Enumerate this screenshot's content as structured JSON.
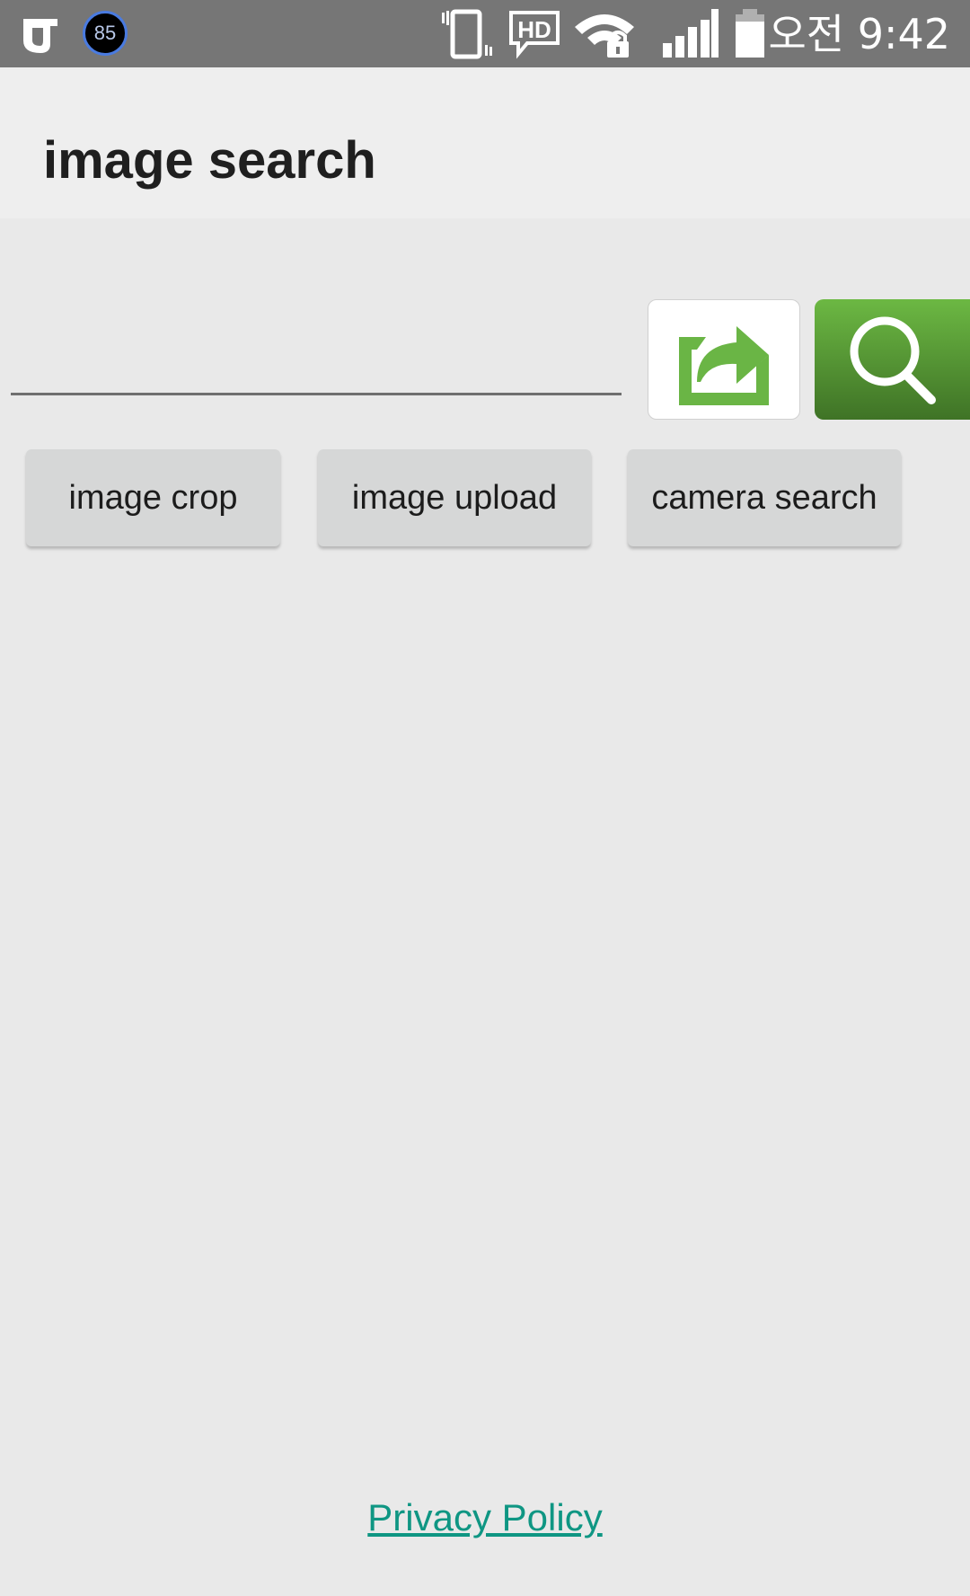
{
  "status_bar": {
    "badge_value": "85",
    "icons": [
      "app-logo-icon",
      "vibrate-icon",
      "hd-voice-icon",
      "wifi-lock-icon",
      "signal-icon",
      "battery-icon"
    ],
    "time": "오전 9:42"
  },
  "toolbar": {
    "title": "image search"
  },
  "search": {
    "value": "",
    "placeholder": ""
  },
  "buttons": {
    "share_icon": "share-icon",
    "search_icon": "search-icon",
    "image_crop": "image crop",
    "image_upload": "image upload",
    "camera_search": "camera search"
  },
  "footer": {
    "privacy_policy": "Privacy Policy"
  },
  "colors": {
    "accent_green": "#6cb843",
    "link_teal": "#0f9683"
  }
}
